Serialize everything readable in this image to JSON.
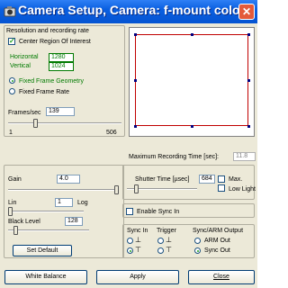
{
  "window": {
    "title": "Camera Setup, Camera: f-mount color",
    "icon": "camera-icon",
    "close_icon": "close-icon"
  },
  "resolution": {
    "group_label": "Resolution and recording rate",
    "center_roi_label": "Center Region Of Interest",
    "center_roi_checked": true,
    "horizontal_label": "Horizontal",
    "horizontal_value": "1280",
    "vertical_label": "Vertical",
    "vertical_value": "1024",
    "fixed_frame_geometry_label": "Fixed Frame Geometry",
    "fixed_frame_rate_label": "Fixed Frame Rate",
    "selected_mode": "Fixed Frame Geometry",
    "frames_label": "Frames/sec",
    "frames_value": "139",
    "frames_min": "1",
    "frames_max": "506"
  },
  "recording": {
    "max_time_label": "Maximum Recording Time [sec]:",
    "max_time_value": "11.8"
  },
  "gain": {
    "gain_label": "Gain",
    "gain_value": "4.0",
    "lin_label": "Lin",
    "lin_value": "1",
    "log_label": "Log",
    "black_level_label": "Black Level",
    "black_level_value": "128",
    "set_default_label": "Set Default"
  },
  "shutter": {
    "label": "Shutter Time [µsec]",
    "value": "684",
    "max_label": "Max.",
    "low_light_label": "Low Light"
  },
  "sync": {
    "enable_sync_label": "Enable Sync In",
    "sync_in_label": "Sync In",
    "trigger_label": "Trigger",
    "output_label": "Sync/ARM Output",
    "arm_out_label": "ARM Out",
    "sync_out_label": "Sync Out",
    "selected_output": "Sync Out"
  },
  "buttons": {
    "white_balance": "White Balance",
    "apply": "Apply",
    "close": "Close"
  },
  "colors": {
    "title_bar": "#0554d2",
    "window_bg": "#ece9d8",
    "accent_green": "#007a00",
    "preview_border": "#c00000"
  }
}
